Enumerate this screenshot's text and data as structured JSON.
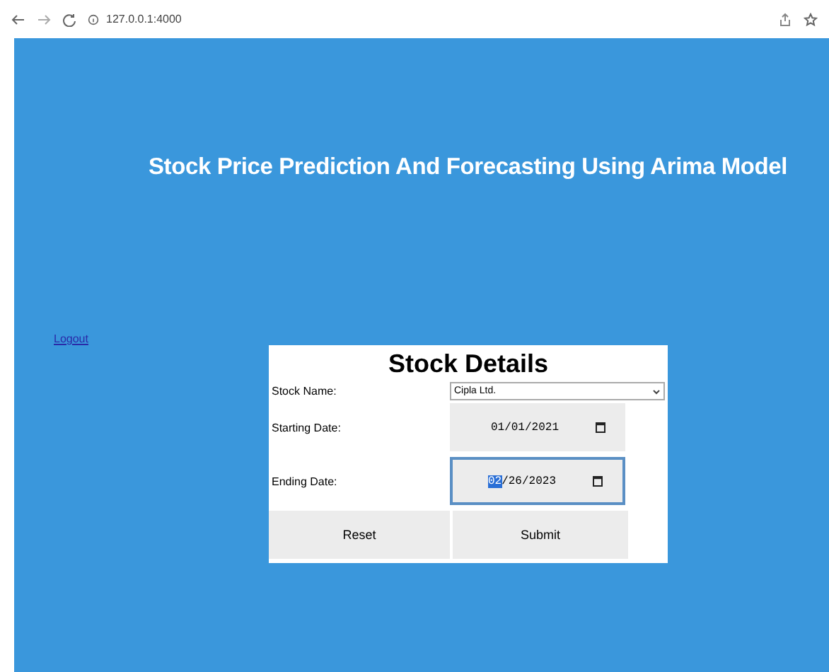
{
  "browser": {
    "url": "127.0.0.1:4000"
  },
  "page": {
    "title": "Stock Price Prediction And Forecasting Using Arima Model",
    "logout": "Logout"
  },
  "form": {
    "heading": "Stock Details",
    "fields": [
      {
        "kind": "select",
        "label": "Stock Name:",
        "value": "Cipla Ltd.",
        "focused": false
      },
      {
        "kind": "date",
        "label": "Starting Date:",
        "value": "01/01/2021",
        "focused": false
      },
      {
        "kind": "date",
        "label": "Ending Date:",
        "value": "02/26/2023",
        "focused": true
      }
    ],
    "buttons": [
      "Reset",
      "Submit"
    ]
  }
}
